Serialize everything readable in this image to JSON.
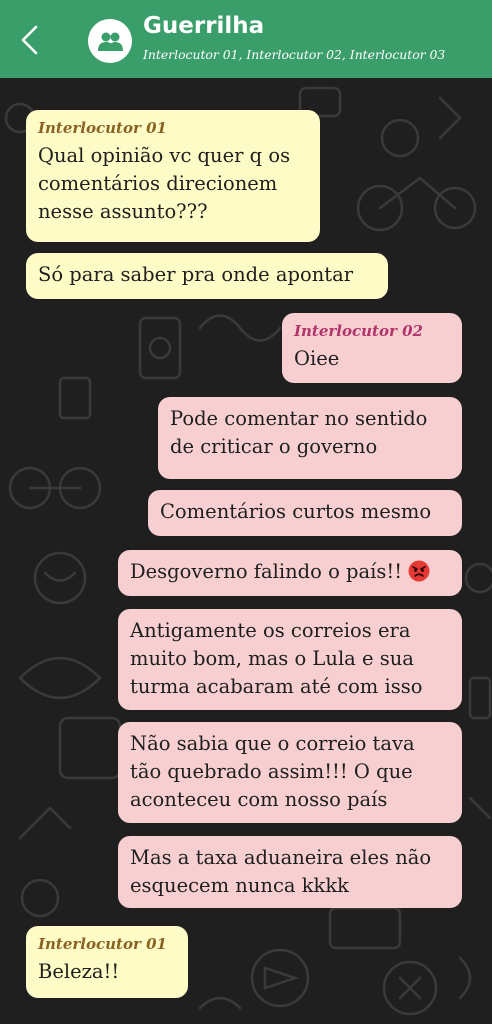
{
  "header": {
    "title": "Guerrilha",
    "participants": "Interlocutor 01, Interlocutor 02, Interlocutor 03",
    "accent_color": "#3a9e6a"
  },
  "messages": [
    {
      "sender": "Interlocutor 01",
      "text": "Qual opinião vc quer q os\ncomentários direcionem\nnesse assunto???",
      "direction": "incoming"
    },
    {
      "text": "Só para saber pra onde apontar",
      "direction": "incoming"
    },
    {
      "sender": "Interlocutor 02",
      "text": "Oiee",
      "direction": "outgoing"
    },
    {
      "text": "Pode comentar no sentido\nde criticar o governo",
      "direction": "outgoing"
    },
    {
      "text": "Comentários curtos mesmo",
      "direction": "outgoing"
    },
    {
      "text": "Desgoverno falindo o país!!",
      "emoji": "angry-face-emoji",
      "direction": "outgoing"
    },
    {
      "text": "Antigamente os correios era\nmuito bom, mas o Lula e sua\nturma acabaram até com isso",
      "direction": "outgoing"
    },
    {
      "text": "Não sabia que o correio tava\ntão quebrado assim!!! O que\naconteceu com nosso país",
      "direction": "outgoing"
    },
    {
      "text": "Mas a taxa aduaneira eles não\nesquecem nunca kkkk",
      "direction": "outgoing"
    },
    {
      "sender": "Interlocutor 01",
      "text": "Beleza!!",
      "direction": "incoming"
    }
  ],
  "colors": {
    "incoming_bubble": "#fdfbc6",
    "outgoing_bubble": "#f7cfd1",
    "chat_background": "#1f1f1f",
    "sender_01": "#8a6224",
    "sender_02": "#b0356a"
  }
}
